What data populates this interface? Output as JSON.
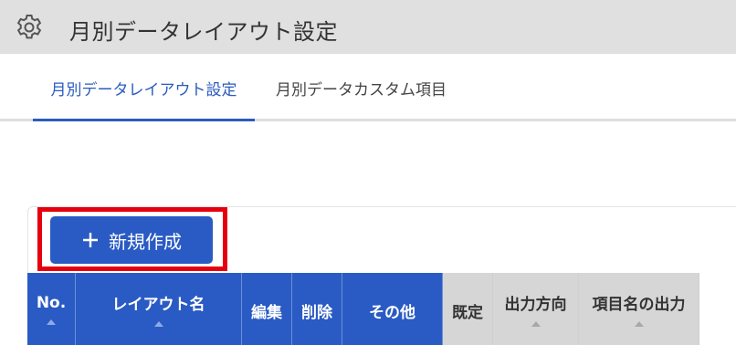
{
  "window": {
    "title": "月別データレイアウト設定",
    "icon": "gear-icon"
  },
  "tabs": [
    {
      "label": "月別データレイアウト設定",
      "active": true
    },
    {
      "label": "月別データカスタム項目",
      "active": false
    }
  ],
  "toolbar": {
    "new_button_label": "新規作成",
    "new_button_icon": "plus-icon",
    "highlight_color": "#e6000f"
  },
  "table": {
    "columns": [
      {
        "label": "No.",
        "sortable": true,
        "style": "blue"
      },
      {
        "label": "レイアウト名",
        "sortable": true,
        "style": "blue"
      },
      {
        "label": "編集",
        "sortable": false,
        "style": "blue"
      },
      {
        "label": "削除",
        "sortable": false,
        "style": "blue"
      },
      {
        "label": "その他",
        "sortable": false,
        "style": "blue"
      },
      {
        "label": "既定",
        "sortable": false,
        "style": "gray"
      },
      {
        "label": "出力方向",
        "sortable": true,
        "style": "gray"
      },
      {
        "label": "項目名の出力",
        "sortable": true,
        "style": "gray"
      }
    ]
  },
  "colors": {
    "accent": "#2a5bc4",
    "titlebar_bg": "#e0e0e0",
    "header_gray": "#d6d6d6"
  }
}
